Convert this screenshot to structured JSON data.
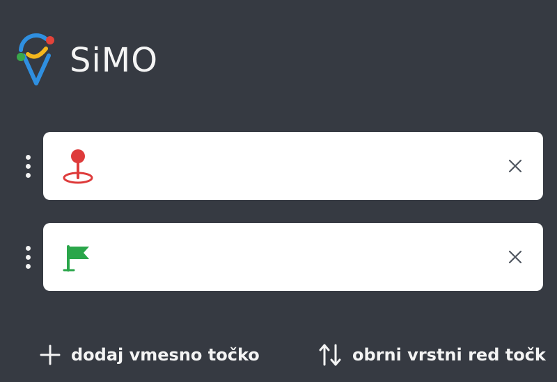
{
  "brand": {
    "name": "SiMO",
    "logo_icon": "simo-pin-logo-icon",
    "colors": {
      "blue": "#2f8fe0",
      "red": "#e3433a",
      "yellow": "#f4b71d",
      "green": "#3aa84a"
    }
  },
  "theme": {
    "background": "#363a42",
    "field_background": "#ffffff",
    "text_light": "#f4f4f4"
  },
  "route": {
    "start": {
      "icon": "location-pin-icon",
      "icon_color": "#de3b3b",
      "value": "",
      "placeholder": "",
      "clear_icon": "close-icon"
    },
    "destination": {
      "icon": "flag-icon",
      "icon_color": "#2aa64a",
      "value": "",
      "placeholder": "",
      "clear_icon": "close-icon"
    }
  },
  "actions": {
    "add_waypoint": {
      "label": "dodaj vmesno točko",
      "icon": "plus-icon"
    },
    "reverse_order": {
      "label": "obrni vrstni red točk",
      "icon": "swap-vertical-icon"
    }
  }
}
